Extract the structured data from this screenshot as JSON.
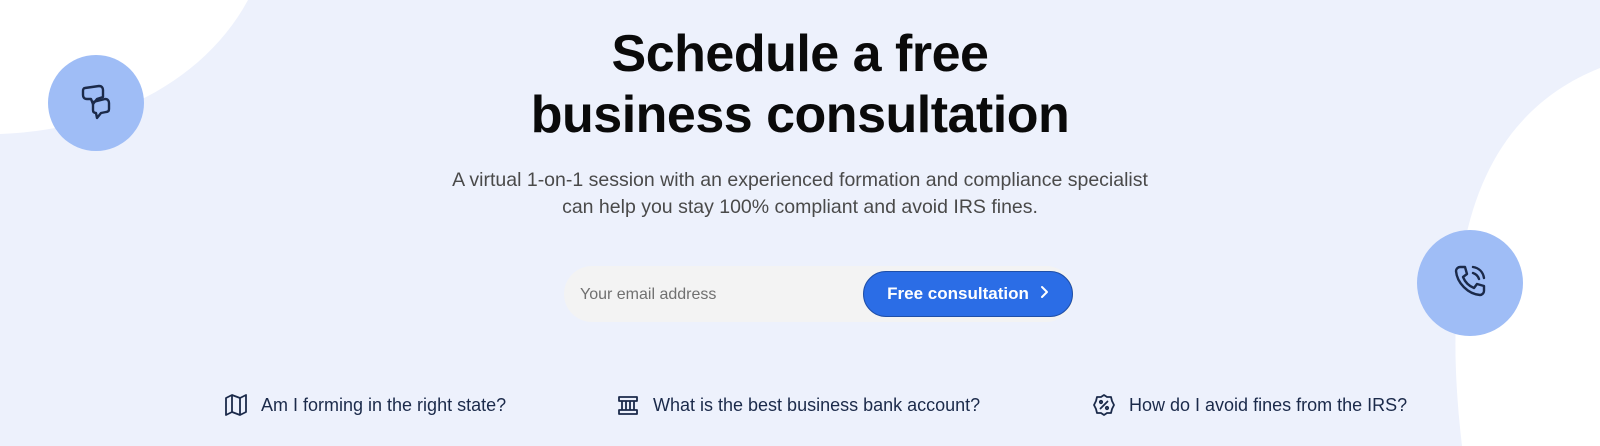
{
  "headline": {
    "line1": "Schedule a free",
    "line2": "business consultation"
  },
  "subtitle": {
    "line1": "A virtual 1-on-1 session with an experienced formation and compliance specialist",
    "line2": "can help you stay 100% compliant and avoid IRS fines."
  },
  "form": {
    "email_placeholder": "Your email address",
    "email_value": "",
    "button_label": "Free consultation",
    "button_icon": "chevron-right-icon"
  },
  "faq": [
    {
      "icon": "map-icon",
      "label": "Am I forming in the right state?"
    },
    {
      "icon": "bank-icon",
      "label": "What is the best business bank account?"
    },
    {
      "icon": "percent-badge-icon",
      "label": "How do I avoid fines from the IRS?"
    }
  ],
  "decor": {
    "left_circle_icon": "chat-bubbles-icon",
    "right_circle_icon": "phone-call-icon"
  },
  "colors": {
    "background": "#edf1fc",
    "accent": "#2b6de6",
    "circle": "#9fbdf6",
    "icon_stroke": "#1b2a4a"
  }
}
